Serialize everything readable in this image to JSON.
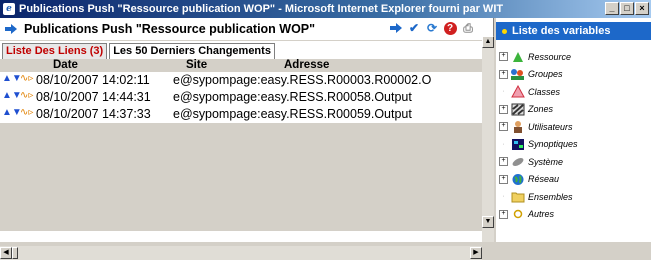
{
  "window": {
    "title": "Publications Push \"Ressource publication WOP\" - Microsoft Internet Explorer fourni par WIT",
    "buttons": [
      "_",
      "□",
      "×"
    ]
  },
  "panel": {
    "title": "Publications Push \"Ressource publication WOP\"",
    "tabs": [
      {
        "label": "Liste Des Liens (3)",
        "active": true
      },
      {
        "label": "Les 50 Derniers Changements",
        "active": false
      }
    ],
    "columns": [
      "Date",
      "Site",
      "Adresse"
    ],
    "rows": [
      {
        "date": "08/10/2007 14:02:11",
        "site": "e@sy",
        "adresse": "pompage:easy.RESS.R00003.R00002.O"
      },
      {
        "date": "08/10/2007 14:44:31",
        "site": "e@sy",
        "adresse": "pompage:easy.RESS.R00058.Output"
      },
      {
        "date": "08/10/2007 14:37:33",
        "site": "e@sy",
        "adresse": "pompage:easy.RESS.R00059.Output"
      }
    ]
  },
  "variables": {
    "title": "Liste des variables",
    "items": [
      {
        "label": "Ressource",
        "icon": "leaf-icon",
        "expandable": true
      },
      {
        "label": "Groupes",
        "icon": "group-icon",
        "expandable": true
      },
      {
        "label": "Classes",
        "icon": "triangle-icon",
        "expandable": false
      },
      {
        "label": "Zones",
        "icon": "zones-icon",
        "expandable": true
      },
      {
        "label": "Utilisateurs",
        "icon": "user-icon",
        "expandable": true
      },
      {
        "label": "Synoptiques",
        "icon": "synoptic-icon",
        "expandable": false
      },
      {
        "label": "Système",
        "icon": "system-icon",
        "expandable": true
      },
      {
        "label": "Réseau",
        "icon": "globe-icon",
        "expandable": true
      },
      {
        "label": "Ensembles",
        "icon": "folder-icon",
        "expandable": false
      },
      {
        "label": "Autres",
        "icon": "circle-icon",
        "expandable": true
      }
    ]
  },
  "colors": {
    "accent": "#1d68c9",
    "active_tab": "#c00000",
    "titlebar": "#0a246a"
  }
}
